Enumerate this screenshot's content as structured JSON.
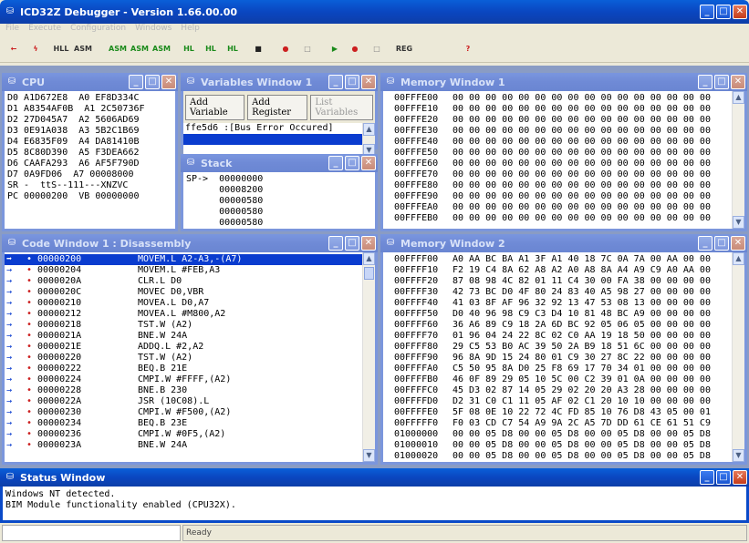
{
  "app": {
    "title": "ICD32Z Debugger - Version 1.66.00.00"
  },
  "menu": [
    "File",
    "Execute",
    "Configuration",
    "Windows",
    "Help"
  ],
  "toolbar": [
    {
      "icon": "back-arrow-icon",
      "label": "←",
      "color": "#cc2020"
    },
    {
      "icon": "lightning-icon",
      "label": "ϟ",
      "color": "#cc2020"
    },
    {
      "icon": "hll-icon",
      "label": "HLL",
      "color": "#333333"
    },
    {
      "icon": "asm-icon",
      "label": "ASM",
      "color": "#333333"
    },
    {
      "icon": "step-asm-icon",
      "label": "ASM",
      "color": "#1a8a1a"
    },
    {
      "icon": "step-asm2-icon",
      "label": "ASM",
      "color": "#1a8a1a"
    },
    {
      "icon": "step-asm3-icon",
      "label": "ASM",
      "color": "#1a8a1a"
    },
    {
      "icon": "step-hll-icon",
      "label": "HL",
      "color": "#1a8a1a"
    },
    {
      "icon": "step-hll2-icon",
      "label": "HL",
      "color": "#1a8a1a"
    },
    {
      "icon": "step-hll3-icon",
      "label": "HL",
      "color": "#1a8a1a"
    },
    {
      "icon": "stop-icon",
      "label": "■",
      "color": "#222222"
    },
    {
      "icon": "breakpoint-icon",
      "label": "●",
      "color": "#cc2020"
    },
    {
      "icon": "clear-breakpoint-icon",
      "label": "□",
      "color": "#888888"
    },
    {
      "icon": "run-icon",
      "label": "▶",
      "color": "#1a8a1a"
    },
    {
      "icon": "run-breakpoint-icon",
      "label": "●",
      "color": "#cc2020"
    },
    {
      "icon": "reset-icon",
      "label": "□",
      "color": "#888888"
    },
    {
      "icon": "registers-icon",
      "label": "REG",
      "color": "#333333"
    },
    {
      "icon": "help-icon",
      "label": "?",
      "color": "#cc2020"
    }
  ],
  "cpu": {
    "title": "CPU",
    "lines": [
      "D0 A1D672E8  A0 EF8D334C",
      "D1 A8354AF0B  A1 2C50736F",
      "D2 27D045A7  A2 5606AD69",
      "D3 0E91A038  A3 5B2C1B69",
      "D4 E6835F09  A4 DA81410B",
      "D5 8C80D390  A5 F3DEA662",
      "D6 CAAFA293  A6 AF5F790D",
      "D7 0A9FD06  A7 00008000",
      "SR -  ttS--111---XNZVC",
      "PC 00000200  VB 00000000"
    ]
  },
  "variables": {
    "title": "Variables Window 1",
    "add_variable": "Add Variable",
    "add_register": "Add Register",
    "list_variables": "List Variables",
    "line1": "ffe5d6 :[Bus Error Occured]",
    "line2": ""
  },
  "stack": {
    "title": "Stack",
    "lines": [
      "SP->  00000000",
      "      00008200",
      "      00000580",
      "      00000580",
      "      00000580"
    ]
  },
  "memory1": {
    "title": "Memory Window 1",
    "rows": [
      [
        "00FFFE00",
        "00 00 00 00 00 00 00 00 00 00 00 00 00 00 00 00"
      ],
      [
        "00FFFE10",
        "00 00 00 00 00 00 00 00 00 00 00 00 00 00 00 00"
      ],
      [
        "00FFFE20",
        "00 00 00 00 00 00 00 00 00 00 00 00 00 00 00 00"
      ],
      [
        "00FFFE30",
        "00 00 00 00 00 00 00 00 00 00 00 00 00 00 00 00"
      ],
      [
        "00FFFE40",
        "00 00 00 00 00 00 00 00 00 00 00 00 00 00 00 00"
      ],
      [
        "00FFFE50",
        "00 00 00 00 00 00 00 00 00 00 00 00 00 00 00 00"
      ],
      [
        "00FFFE60",
        "00 00 00 00 00 00 00 00 00 00 00 00 00 00 00 00"
      ],
      [
        "00FFFE70",
        "00 00 00 00 00 00 00 00 00 00 00 00 00 00 00 00"
      ],
      [
        "00FFFE80",
        "00 00 00 00 00 00 00 00 00 00 00 00 00 00 00 00"
      ],
      [
        "00FFFE90",
        "00 00 00 00 00 00 00 00 00 00 00 00 00 00 00 00"
      ],
      [
        "00FFFEA0",
        "00 00 00 00 00 00 00 00 00 00 00 00 00 00 00 00"
      ],
      [
        "00FFFEB0",
        "00 00 00 00 00 00 00 00 00 00 00 00 00 00 00 00"
      ]
    ]
  },
  "code": {
    "title": "Code Window 1 : Disassembly",
    "rows": [
      [
        "00000200",
        "MOVEM.L A2-A3,-(A7)"
      ],
      [
        "00000204",
        "MOVEM.L #FEB,A3"
      ],
      [
        "0000020A",
        "CLR.L D0"
      ],
      [
        "0000020C",
        "MOVEC D0,VBR"
      ],
      [
        "00000210",
        "MOVEA.L D0,A7"
      ],
      [
        "00000212",
        "MOVEA.L #M800,A2"
      ],
      [
        "00000218",
        "TST.W (A2)"
      ],
      [
        "0000021A",
        "BNE.W 24A"
      ],
      [
        "0000021E",
        "ADDQ.L #2,A2"
      ],
      [
        "00000220",
        "TST.W (A2)"
      ],
      [
        "00000222",
        "BEQ.B 21E"
      ],
      [
        "00000224",
        "CMPI.W #FFFF,(A2)"
      ],
      [
        "00000228",
        "BNE.B 230"
      ],
      [
        "0000022A",
        "JSR (10C08).L"
      ],
      [
        "00000230",
        "CMPI.W #F500,(A2)"
      ],
      [
        "00000234",
        "BEQ.B 23E"
      ],
      [
        "00000236",
        "CMPI.W #0F5,(A2)"
      ],
      [
        "0000023A",
        "BNE.W 24A"
      ]
    ]
  },
  "memory2": {
    "title": "Memory Window 2",
    "rows": [
      [
        "00FFFF00",
        "A0 AA BC BA A1 3F A1 40 18 7C 0A 7A 00 AA 00 00"
      ],
      [
        "00FFFF10",
        "F2 19 C4 8A 62 A8 A2 A0 A8 8A A4 A9 C9 A0 AA 00"
      ],
      [
        "00FFFF20",
        "87 08 98 4C 82 01 11 C4 30 00 FA 38 00 00 00 00"
      ],
      [
        "00FFFF30",
        "42 73 BC D0 4F 80 24 83 40 A5 98 27 00 00 00 00"
      ],
      [
        "00FFFF40",
        "41 03 8F AF 96 32 92 13 47 53 08 13 00 00 00 00"
      ],
      [
        "00FFFF50",
        "D0 40 96 98 C9 C3 D4 10 81 48 BC A9 00 00 00 00"
      ],
      [
        "00FFFF60",
        "36 A6 89 C9 18 2A 6D BC 92 05 06 05 00 00 00 00"
      ],
      [
        "00FFFF70",
        "01 96 04 24 22 8C 02 C0 AA 19 18 50 00 00 00 00"
      ],
      [
        "00FFFF80",
        "29 C5 53 B0 AC 39 50 2A B9 18 51 6C 00 00 00 00"
      ],
      [
        "00FFFF90",
        "96 8A 9D 15 24 80 01 C9 30 27 8C 22 00 00 00 00"
      ],
      [
        "00FFFFA0",
        "C5 50 95 8A D0 25 F8 69 17 70 34 01 00 00 00 00"
      ],
      [
        "00FFFFB0",
        "46 0F 89 29 05 10 5C 00 C2 39 01 0A 00 00 00 00"
      ],
      [
        "00FFFFC0",
        "45 D3 02 87 14 05 29 02 20 20 A3 28 00 00 00 00"
      ],
      [
        "00FFFFD0",
        "D2 31 C0 C1 11 05 AF 02 C1 20 10 10 00 00 00 00"
      ],
      [
        "00FFFFE0",
        "5F 08 0E 10 22 72 4C FD 85 10 76 D8 43 05 00 01"
      ],
      [
        "00FFFFF0",
        "F0 03 CD C7 54 A9 9A 2C A5 7D DD 61 CE 61 51 C9"
      ],
      [
        "01000000",
        "00 00 05 D8 00 00 05 D8 00 00 05 D8 00 00 05 D8"
      ],
      [
        "01000010",
        "00 00 05 D8 00 00 05 D8 00 00 05 D8 00 00 05 D8"
      ],
      [
        "01000020",
        "00 00 05 D8 00 00 05 D8 00 00 05 D8 00 00 05 D8"
      ]
    ]
  },
  "status": {
    "title": "Status Window",
    "lines": [
      "Windows NT detected.",
      "BIM Module functionality enabled (CPU32X)."
    ],
    "bar_left": "",
    "bar_right": "Ready"
  }
}
